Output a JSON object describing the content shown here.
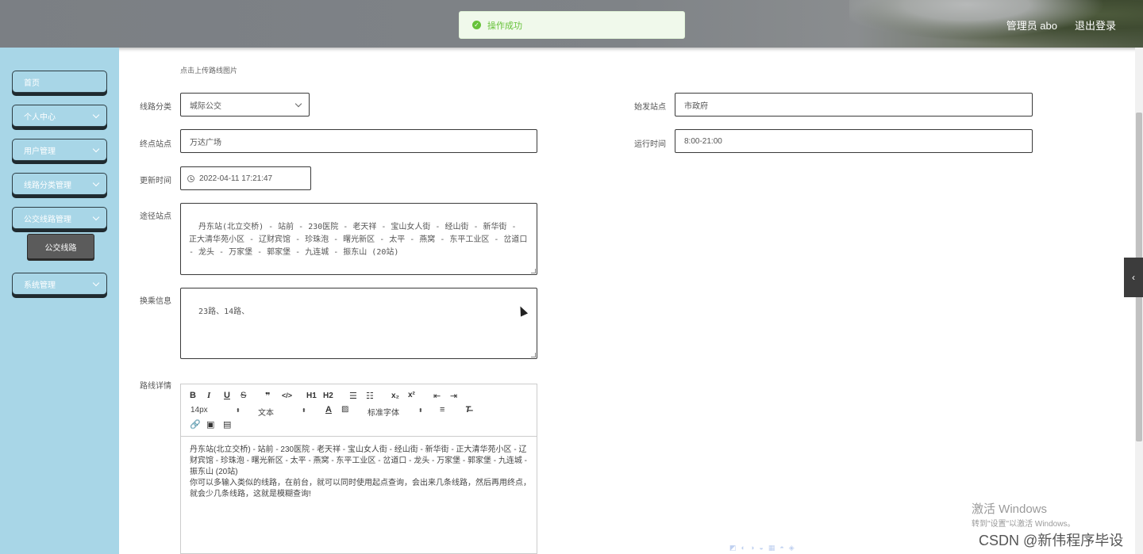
{
  "header": {
    "user_label": "管理员 abo",
    "logout_label": "退出登录"
  },
  "toast": {
    "message": "操作成功"
  },
  "sidebar": {
    "items": [
      {
        "label": "首页"
      },
      {
        "label": "个人中心"
      },
      {
        "label": "用户管理"
      },
      {
        "label": "线路分类管理"
      },
      {
        "label": "公交线路管理"
      },
      {
        "label": "系统管理"
      }
    ],
    "sub_item": {
      "label": "公交线路"
    }
  },
  "form": {
    "upload_hint": "点击上传路线图片",
    "category": {
      "label": "线路分类",
      "value": "城际公交"
    },
    "start": {
      "label": "始发站点",
      "value": "市政府"
    },
    "end": {
      "label": "终点站点",
      "value": "万达广场"
    },
    "run_time": {
      "label": "运行时间",
      "value": "8:00-21:00"
    },
    "update_time": {
      "label": "更新时间",
      "value": "2022-04-11 17:21:47"
    },
    "stops": {
      "label": "途径站点",
      "value": "丹东站(北立交桥) - 站前 - 230医院 - 老天祥 - 宝山女人街 - 经山街 - 新华街 - 正大清华苑小区 - 辽财宾馆 - 珍珠泡 - 曙光新区 - 太平 - 燕窝 - 东平工业区 - 岔道口 - 龙头 - 万家堡 - 郭家堡 - 九连城 - 振东山 (20站)"
    },
    "transfer": {
      "label": "换乘信息",
      "value": "23路、14路、"
    },
    "details": {
      "label": "路线详情",
      "content_line1": "丹东站(北立交桥) - 站前 - 230医院 - 老天祥 - 宝山女人街 - 经山街 - 新华街 - 正大清华苑小区 - 辽财宾馆 - 珍珠泡 - 曙光新区 - 太平 - 燕窝 - 东平工业区 - 岔道口 - 龙头 - 万家堡 - 郭家堡 - 九连城 - 振东山 (20站)",
      "content_line2": "你可以多输入类似的线路，在前台，就可以同时使用起点查询，会出来几条线路，然后再用终点，就会少几条线路，这就是模糊查询!"
    }
  },
  "editor": {
    "font_size": "14px",
    "block_type": "文本",
    "font_family": "标准字体",
    "buttons": {
      "bold": "B",
      "italic": "I",
      "underline": "U",
      "strike": "S",
      "quote": "❞",
      "code": "</>",
      "h1": "H1",
      "h2": "H2",
      "sub": "x₂",
      "sup": "x²"
    }
  },
  "watermark": {
    "line1": "激活 Windows",
    "line2": "转到\"设置\"以激活 Windows。",
    "csdn": "CSDN @新伟程序毕设"
  }
}
